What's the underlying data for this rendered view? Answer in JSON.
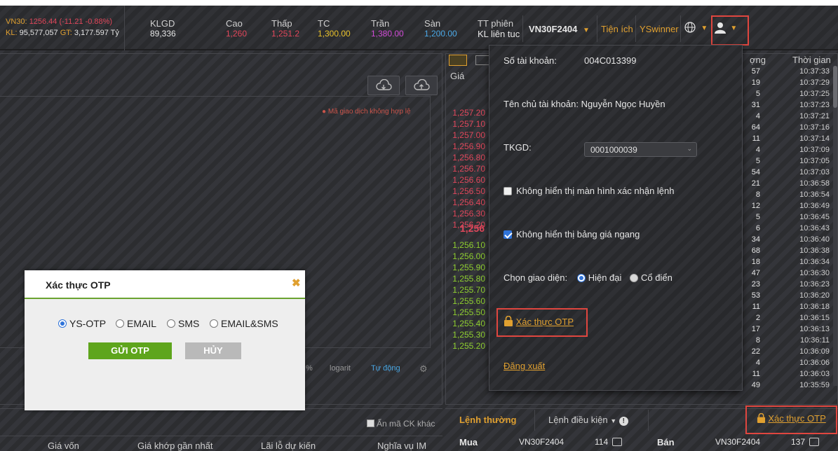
{
  "header": {
    "index_label": "VN30:",
    "index_value": "1256.44 (-11.21 -0.88%)",
    "kl_label": "KL:",
    "kl_value": "95,577,057",
    "gt_label": "GT:",
    "gt_value": "3,177.597 Tỷ",
    "klgd_label": "KLGD",
    "klgd_value": "89,336",
    "cao_label": "Cao",
    "cao_value": "1,260",
    "thap_label": "Thấp",
    "thap_value": "1,251.2",
    "tc_label": "TC",
    "tc_value": "1,300.00",
    "tran_label": "Trần",
    "tran_value": "1,380.00",
    "san_label": "Sàn",
    "san_value": "1,200.00",
    "tt_label": "TT phiên",
    "tt_value": "KL liên tục",
    "symbol": "VN30F2404",
    "menu_tien_ich": "Tiện ích",
    "menu_yswinner": "YSwinner"
  },
  "chart_panel": {
    "invalid_msg": "● Mã giao dịch không hợp lệ",
    "pct_label": "%",
    "logarit_label": "logarit",
    "auto_label": "Tự động"
  },
  "price_board": {
    "col_price": "Giá",
    "col_qty": "ợng",
    "col_time": "Thời gian",
    "ask_prices": [
      "1,257.20",
      "1,257.10",
      "1,257.00",
      "1,256.90",
      "1,256.80",
      "1,256.70",
      "1,256.60",
      "1,256.50",
      "1,256.40",
      "1,256.30",
      "1,256.20"
    ],
    "current_price": "1,256",
    "bid_prices": [
      "1,256.10",
      "1,256.00",
      "1,255.90",
      "1,255.80",
      "1,255.70",
      "1,255.60",
      "1,255.50",
      "1,255.40",
      "1,255.30",
      "1,255.20"
    ],
    "qty": [
      "57",
      "19",
      "5",
      "31",
      "4",
      "64",
      "11",
      "4",
      "5",
      "54",
      "21",
      "8",
      "12",
      "5",
      "6",
      "34",
      "68",
      "18",
      "47",
      "23",
      "53",
      "11",
      "2",
      "17",
      "8",
      "22",
      "4",
      "11",
      "49"
    ],
    "times": [
      "10:37:33",
      "10:37:29",
      "10:37:25",
      "10:37:23",
      "10:37:21",
      "10:37:16",
      "10:37:14",
      "10:37:09",
      "10:37:05",
      "10:37:03",
      "10:36:58",
      "10:36:54",
      "10:36:49",
      "10:36:45",
      "10:36:43",
      "10:36:40",
      "10:36:38",
      "10:36:34",
      "10:36:30",
      "10:36:23",
      "10:36:20",
      "10:36:18",
      "10:36:15",
      "10:36:13",
      "10:36:11",
      "10:36:09",
      "10:36:06",
      "10:36:03",
      "10:35:59"
    ]
  },
  "account_menu": {
    "account_no_label": "Số tài khoản:",
    "account_no": "004C013399",
    "owner_label": "Tên chủ tài khoản:",
    "owner": "Nguyễn Ngọc Huyền",
    "tkgd_label": "TKGD:",
    "tkgd_value": "0001000039",
    "hide_confirm": "Không hiển thị màn hình xác nhận lệnh",
    "hide_horizontal": "Không hiển thị bảng giá ngang",
    "theme_label": "Chọn giao diện:",
    "theme_modern": "Hiện đại",
    "theme_classic": "Cổ điển",
    "otp_link": "Xác thực OTP",
    "logout": "Đăng xuất"
  },
  "bottom": {
    "hide_ck": "Ẩn mã CK khác",
    "col_cost": "Giá vốn",
    "col_last": "Giá khớp gần nhất",
    "col_pl": "Lãi lỗ dự kiến",
    "col_im": "Nghĩa vụ IM",
    "tab_normal": "Lệnh thường",
    "tab_conditional": "Lệnh điều kiện",
    "buy_label": "Mua",
    "buy_symbol": "VN30F2404",
    "buy_qty": "114",
    "sell_label": "Bán",
    "sell_symbol": "VN30F2404",
    "sell_qty": "137",
    "otp_link": "Xác thực OTP"
  },
  "otp_modal": {
    "title": "Xác thực OTP",
    "opt_ysotp": "YS-OTP",
    "opt_email": "EMAIL",
    "opt_sms": "SMS",
    "opt_emailsms": "EMAIL&SMS",
    "send_button": "GỬI OTP",
    "cancel_button": "HỦY"
  },
  "colors": {
    "accent_orange": "#e0a030",
    "ask_red": "#e0475b",
    "bid_green": "#8fcf2f",
    "ceiling_purple": "#d04ad6",
    "floor_blue": "#4aa8e6",
    "ref_yellow": "#e8c02a"
  }
}
